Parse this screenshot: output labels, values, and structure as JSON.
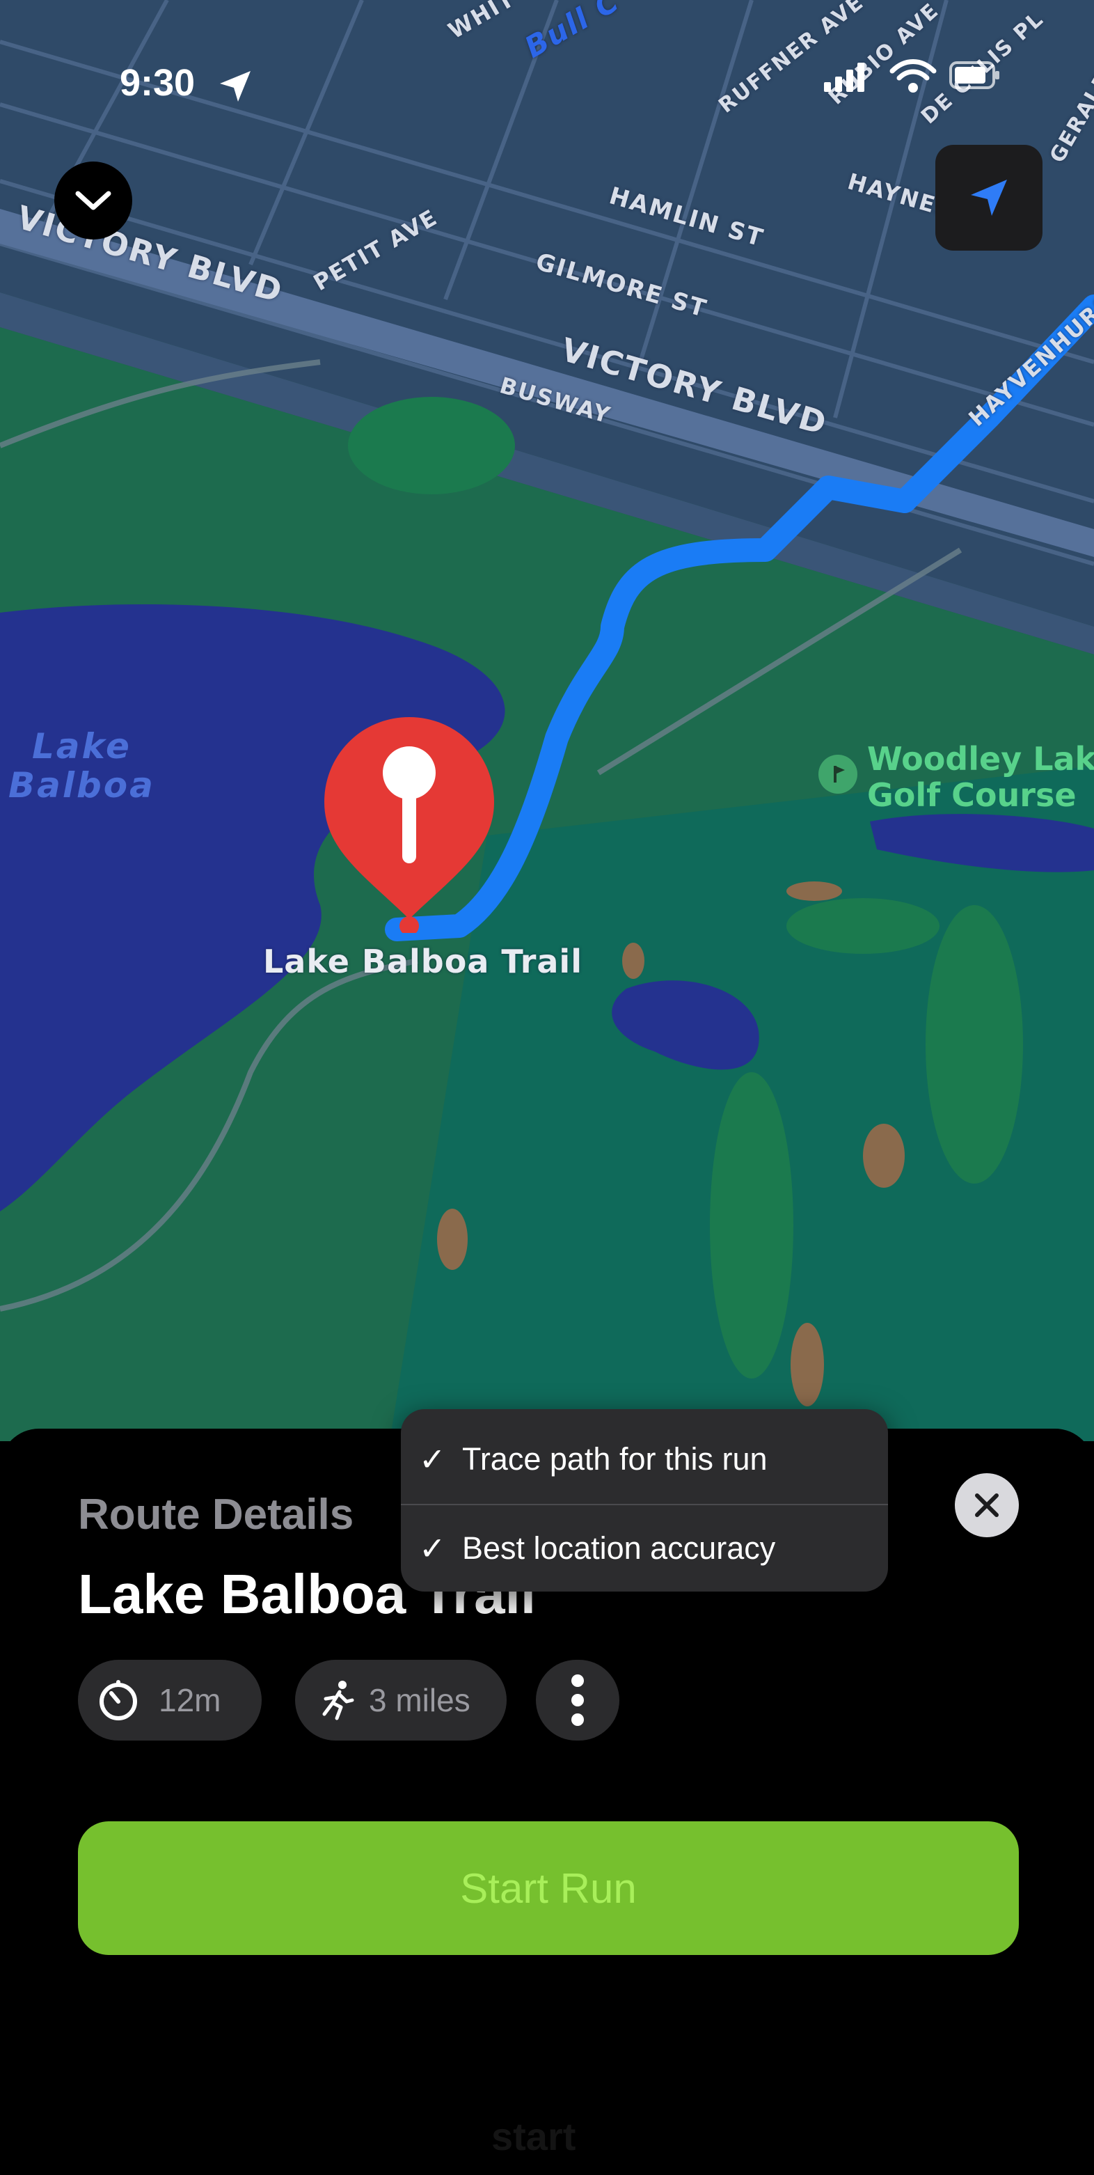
{
  "status_bar": {
    "time": "9:30"
  },
  "map": {
    "street_labels": [
      "WHIT",
      "Bull C",
      "RUFFNER AVE",
      "RUBIO AVE",
      "DE CELIS PL",
      "GERALD",
      "HAYNES",
      "HAMLIN ST",
      "VICTORY BLVD",
      "PETIT AVE",
      "GILMORE ST",
      "VICTORY BLVD",
      "BUSWAY",
      "HAYVENHURST"
    ],
    "water_label_line1": "Lake",
    "water_label_line2": "Balboa",
    "poi_label_line1": "Woodley Lake",
    "poi_label_line2": "Golf Course",
    "pin_label": "Lake Balboa Trail",
    "route_color": "#1a7cf5",
    "pin_color": "#e53935"
  },
  "sheet": {
    "subtitle": "Route Details",
    "title": "Lake Balboa Trail",
    "chips": [
      {
        "icon": "timer-icon",
        "label": "12m"
      },
      {
        "icon": "runner-icon",
        "label": "3 miles"
      }
    ],
    "start_button": "Start Run",
    "accent_color": "#76c02e",
    "ghost_label": "start"
  },
  "menu": {
    "items": [
      {
        "check": "✓",
        "label": "Trace path for this run"
      },
      {
        "check": "✓",
        "label": "Best location accuracy"
      }
    ]
  }
}
